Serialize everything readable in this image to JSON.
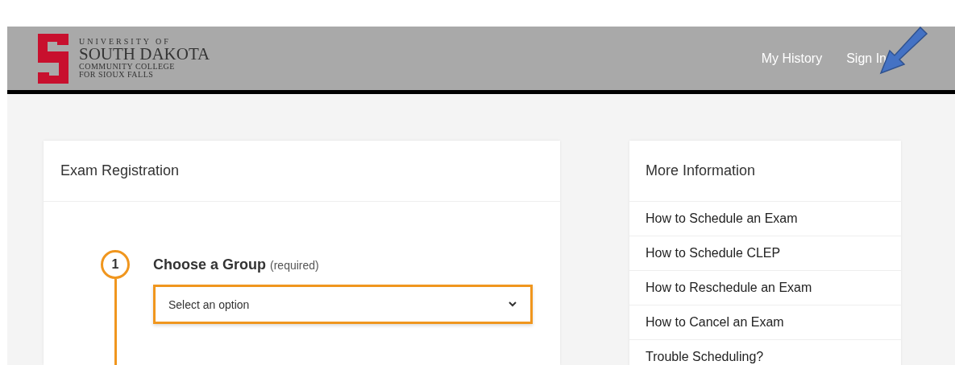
{
  "header": {
    "logo_lines": [
      "UNIVERSITY OF",
      "SOUTH DAKOTA",
      "COMMUNITY COLLEGE",
      "FOR SIOUX FALLS"
    ],
    "nav": [
      {
        "label": "My History"
      },
      {
        "label": "Sign In"
      }
    ]
  },
  "registration": {
    "title": "Exam Registration",
    "steps": [
      {
        "number": "1",
        "title": "Choose a Group",
        "note": "(required)",
        "select": {
          "placeholder": "Select an option"
        }
      }
    ]
  },
  "more_information": {
    "title": "More Information",
    "links": [
      "How to Schedule an Exam",
      "How to Schedule CLEP",
      "How to Reschedule an Exam",
      "How to Cancel an Exam",
      "Trouble Scheduling?"
    ]
  }
}
